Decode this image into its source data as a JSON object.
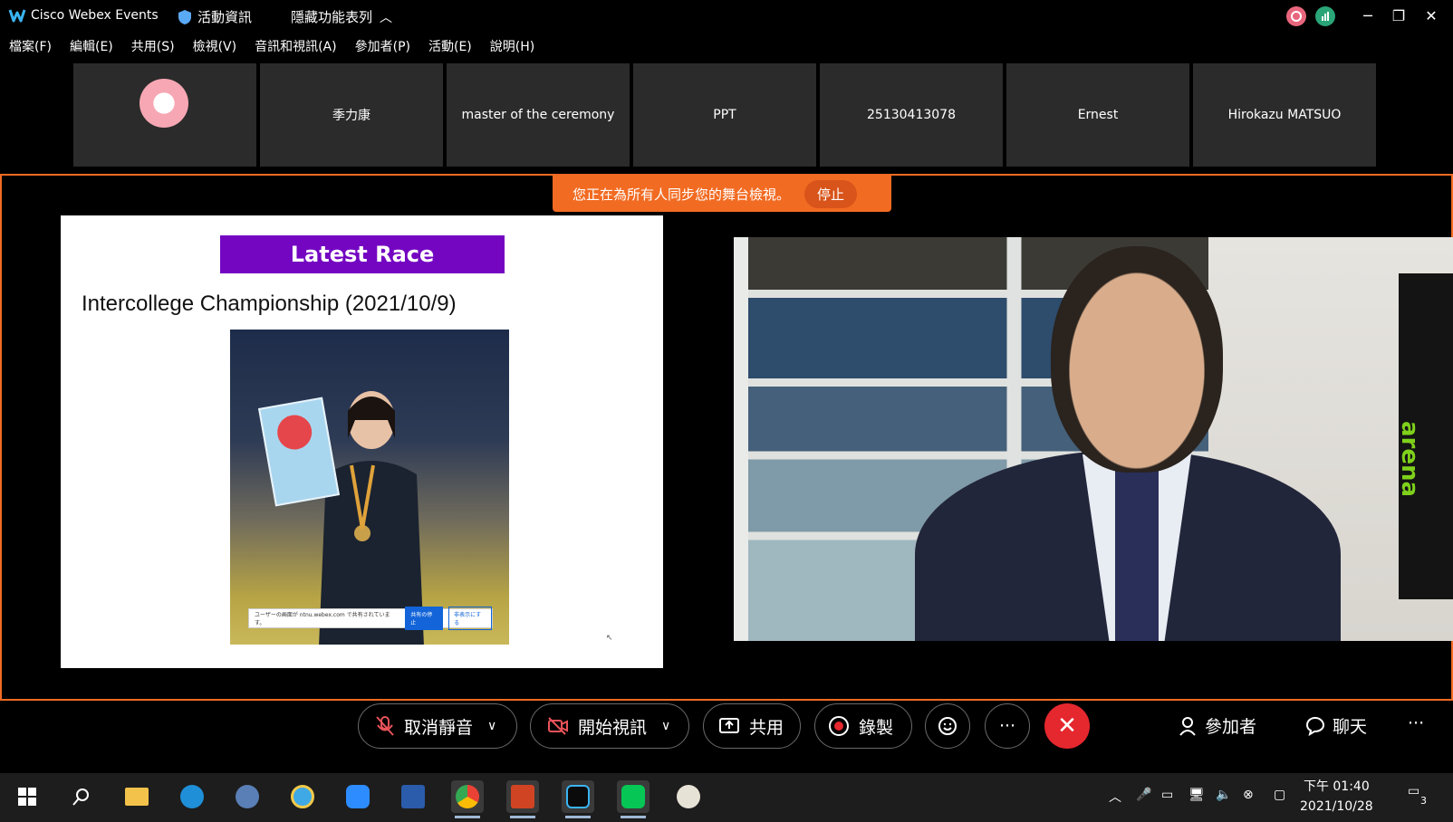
{
  "titlebar": {
    "app_title": "Cisco Webex Events",
    "event_info": "活動資訊",
    "hide_toolbar": "隱藏功能表列"
  },
  "menu": [
    "檔案(F)",
    "編輯(E)",
    "共用(S)",
    "檢視(V)",
    "音訊和視訊(A)",
    "參加者(P)",
    "活動(E)",
    "說明(H)"
  ],
  "participants": [
    "季力康",
    "master of the ceremony",
    "PPT",
    "25130413078",
    "Ernest",
    "Hirokazu MATSUO"
  ],
  "stage": {
    "sync_message": "您正在為所有人同步您的舞台檢視。",
    "stop_label": "停止"
  },
  "slide": {
    "header": "Latest Race",
    "subtitle": "Intercollege Championship (2021/10/9)",
    "share_text": "ユーザーの画面が ntnu.webex.com で共有されています。",
    "share_stop": "共有の停止",
    "share_show": "非表示にする"
  },
  "video": {
    "bag_text": "arena"
  },
  "controls": {
    "unmute": "取消靜音",
    "start_video": "開始視訊",
    "share": "共用",
    "record": "錄製",
    "participants": "參加者",
    "chat": "聊天"
  },
  "taskbar": {
    "time": "下午 01:40",
    "date": "2021/10/28",
    "notification_count": "3"
  },
  "colors": {
    "accent_orange": "#f26b22",
    "slide_header": "#7406c2",
    "end_red": "#e5272e"
  }
}
